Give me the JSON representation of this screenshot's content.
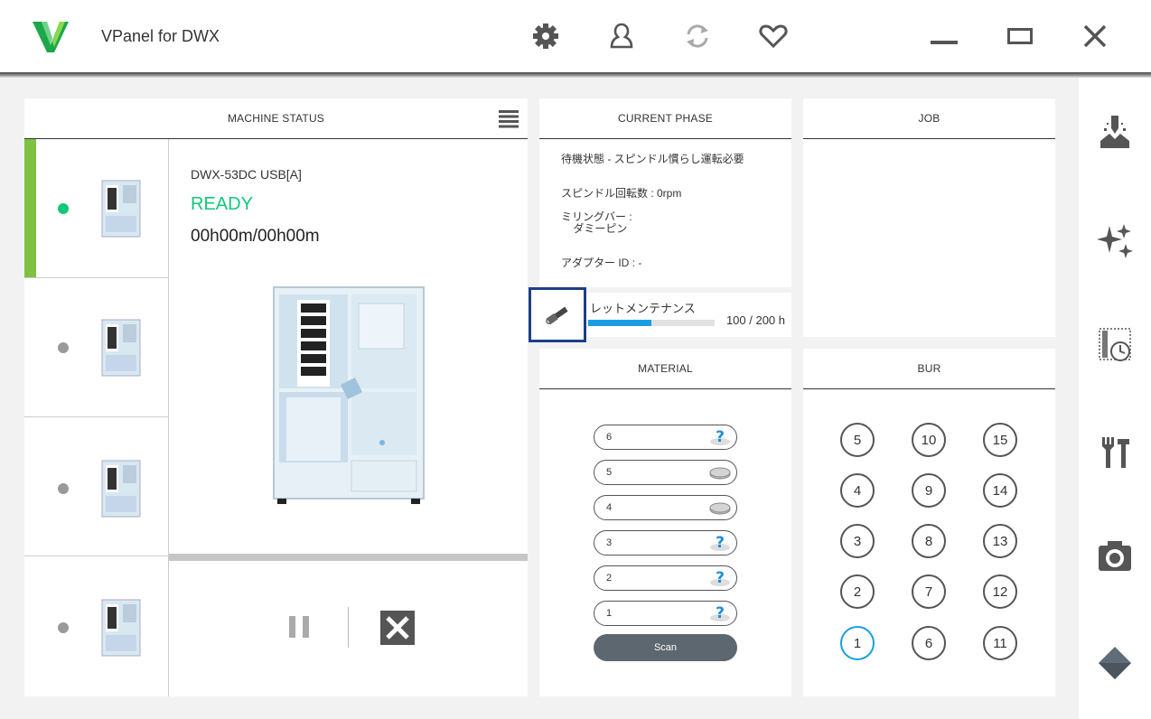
{
  "app": {
    "title": "VPanel for DWX"
  },
  "colors": {
    "accent_green": "#7dc242",
    "ready_green": "#12c77a",
    "progress_blue": "#1a9ee3",
    "highlight_border": "#1d3f8a"
  },
  "toolbar_icons": [
    "gear-icon",
    "user-icon",
    "refresh-icon",
    "heart-icon"
  ],
  "window_buttons": [
    "minimize",
    "maximize",
    "close"
  ],
  "machine_status": {
    "header": "MACHINE STATUS",
    "machines": [
      {
        "status": "ready",
        "selected": true
      },
      {
        "status": "idle",
        "selected": false
      },
      {
        "status": "idle",
        "selected": false
      },
      {
        "status": "idle",
        "selected": false
      }
    ],
    "selected": {
      "name": "DWX-53DC USB[A]",
      "state": "READY",
      "time": "00h00m/00h00m"
    }
  },
  "current_phase": {
    "header": "CURRENT PHASE",
    "status_line": "待機状態 - スピンドル慣らし運転必要",
    "spindle_speed": "スピンドル回転数 : 0rpm",
    "milling_bar": "ミリングバー :\n    ダミーピン",
    "adapter_id": "アダプター ID : -",
    "maintenance": {
      "label": "レットメンテナンス",
      "hours": "100 / 200 h",
      "progress": 0.5
    }
  },
  "job": {
    "header": "JOB"
  },
  "material": {
    "header": "MATERIAL",
    "slots": [
      {
        "num": "6",
        "icon": "question-icon"
      },
      {
        "num": "5",
        "icon": "disc-icon"
      },
      {
        "num": "4",
        "icon": "disc-icon"
      },
      {
        "num": "3",
        "icon": "question-icon"
      },
      {
        "num": "2",
        "icon": "question-icon"
      },
      {
        "num": "1",
        "icon": "question-icon"
      }
    ],
    "scan_label": "Scan"
  },
  "bur": {
    "header": "BUR",
    "columns": [
      [
        "5",
        "4",
        "3",
        "2",
        "1"
      ],
      [
        "10",
        "9",
        "8",
        "7",
        "6"
      ],
      [
        "15",
        "14",
        "13",
        "12",
        "11"
      ]
    ],
    "selected": "1"
  },
  "sidebar_icons": [
    "milling-icon",
    "sparkle-icon",
    "tool-time-icon",
    "tools-icon",
    "camera-icon",
    "diamond-icon"
  ]
}
